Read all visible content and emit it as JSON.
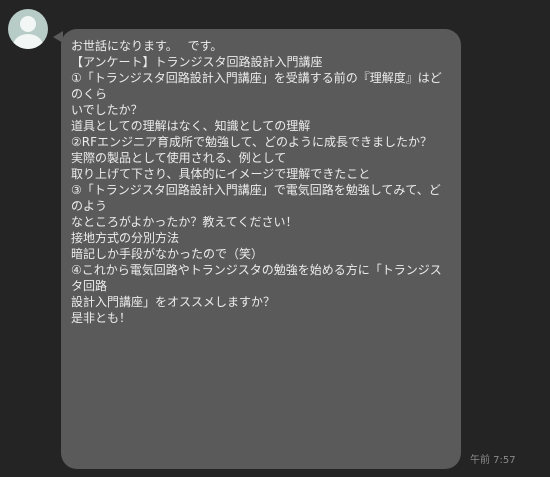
{
  "chat": {
    "avatar_icon": "user-avatar-icon",
    "lines": [
      "お世話になります。　 です。",
      "【アンケート】トランジスタ回路設計入門講座",
      "",
      "①「トランジスタ回路設計入門講座」を受講する前の『理解度』はどのくら",
      "いでしたか？",
      "",
      "道具としての理解はなく、知識としての理解",
      "",
      "②RFエンジニア育成所で勉強して、どのように成長できましたか？",
      "",
      "実際の製品として使用される、例として",
      "取り上げて下さり、具体的にイメージで理解できたこと",
      "",
      "③「トランジスタ回路設計入門講座」で電気回路を勉強してみて、どのよう",
      "なところがよかったか？教えてください！",
      "",
      "接地方式の分別方法",
      "暗記しか手段がなかったので（笑）",
      "",
      "④これから電気回路やトランジスタの勉強を始める方に「トランジスタ回路",
      "設計入門講座」をオススメしますか？",
      "",
      "是非とも！"
    ],
    "timestamp": "午前 7:57"
  }
}
